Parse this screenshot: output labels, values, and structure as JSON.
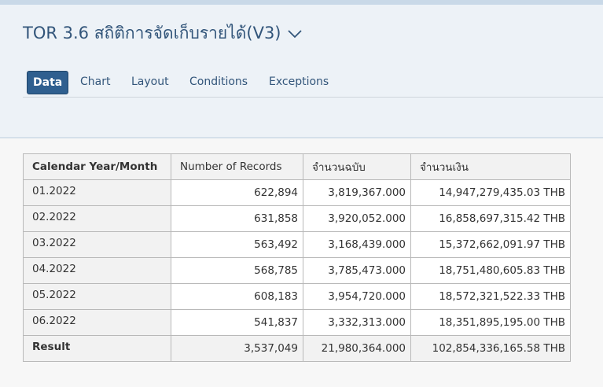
{
  "app": {
    "title": "TOR 3.6 สถิติการจัดเก็บรายได้(V3)"
  },
  "tabs": [
    {
      "label": "Data",
      "active": true
    },
    {
      "label": "Chart",
      "active": false
    },
    {
      "label": "Layout",
      "active": false
    },
    {
      "label": "Conditions",
      "active": false
    },
    {
      "label": "Exceptions",
      "active": false
    }
  ],
  "table": {
    "headers": [
      "Calendar Year/Month",
      "Number of Records",
      "จำนวนฉบับ",
      "จำนวนเงิน"
    ],
    "rows": [
      [
        "01.2022",
        "622,894",
        "3,819,367.000",
        "14,947,279,435.03 THB"
      ],
      [
        "02.2022",
        "631,858",
        "3,920,052.000",
        "16,858,697,315.42 THB"
      ],
      [
        "03.2022",
        "563,492",
        "3,168,439.000",
        "15,372,662,091.97 THB"
      ],
      [
        "04.2022",
        "568,785",
        "3,785,473.000",
        "18,751,480,605.83 THB"
      ],
      [
        "05.2022",
        "608,183",
        "3,954,720.000",
        "18,572,321,522.33 THB"
      ],
      [
        "06.2022",
        "541,837",
        "3,332,313.000",
        "18,351,895,195.00 THB"
      ]
    ],
    "result": [
      "Result",
      "3,537,049",
      "21,980,364.000",
      "102,854,336,165.58 THB"
    ]
  },
  "colors": {
    "accent": "#2f5f8f",
    "title": "#32557a",
    "header_bg": "#edf2f7"
  },
  "icons": {
    "title_dropdown": "chevron-down-icon"
  }
}
